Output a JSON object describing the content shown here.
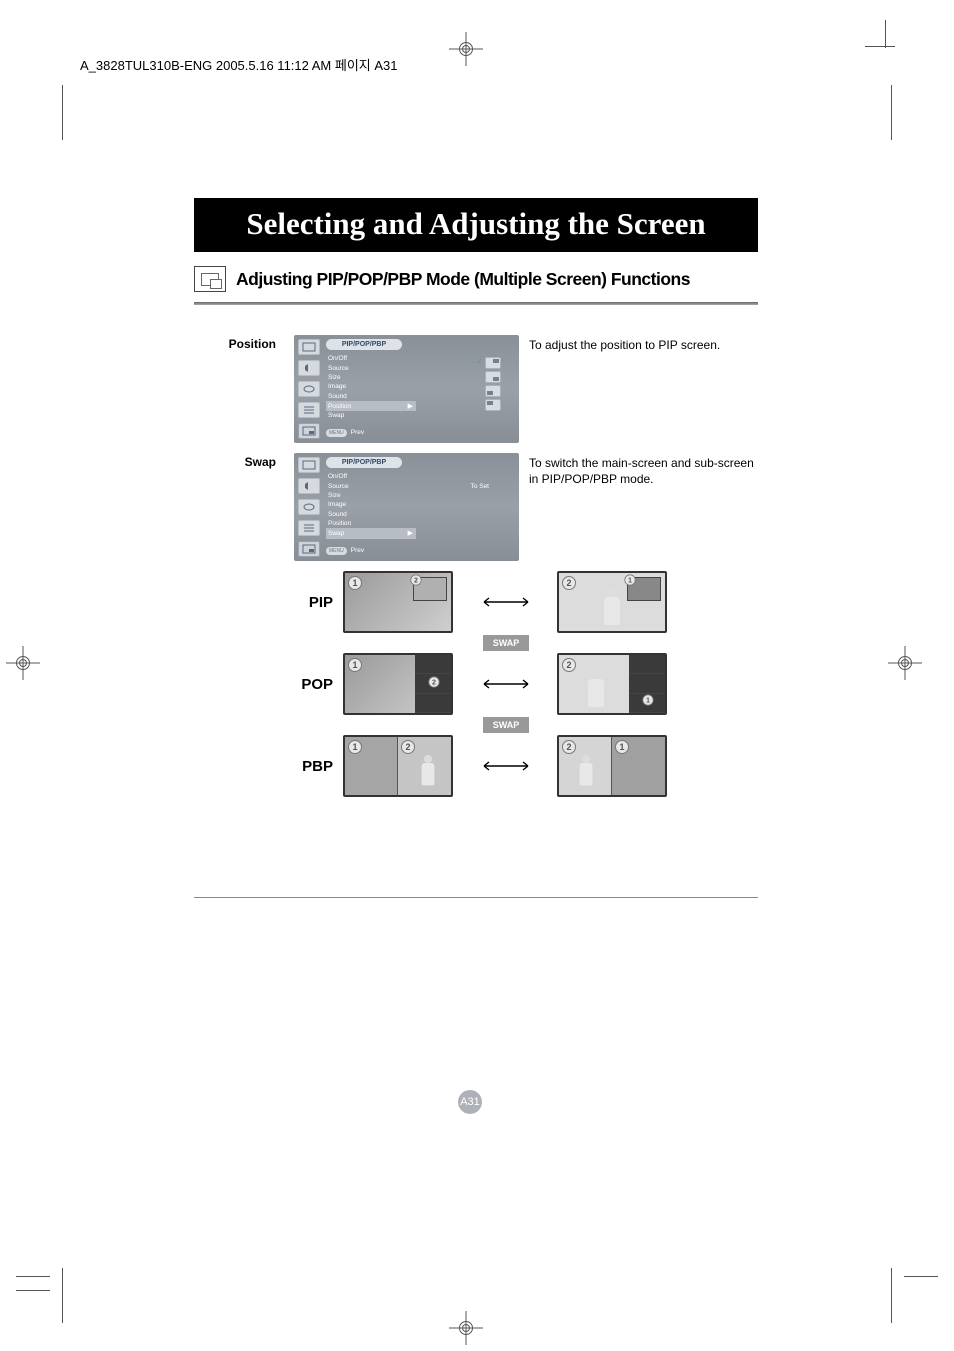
{
  "header": "A_3828TUL310B-ENG  2005.5.16  11:12 AM  페이지 A31",
  "title": "Selecting and Adjusting the Screen",
  "subtitle": "Adjusting PIP/POP/PBP Mode (Multiple Screen) Functions",
  "sections": {
    "position": {
      "label": "Position",
      "desc": "To adjust the position to PIP screen."
    },
    "swap": {
      "label": "Swap",
      "desc": "To switch the main-screen and sub-screen in PIP/POP/PBP mode."
    }
  },
  "osd": {
    "title": "PIP/POP/PBP",
    "items": [
      "On/Off",
      "Source",
      "Size",
      "Image",
      "Sound",
      "Position",
      "Swap"
    ],
    "prev": "Prev",
    "menu_pill": "MENU",
    "toset": "To Set"
  },
  "modes": {
    "pip": "PIP",
    "pop": "POP",
    "pbp": "PBP"
  },
  "swap_badge": "SWAP",
  "page_number": "A31"
}
